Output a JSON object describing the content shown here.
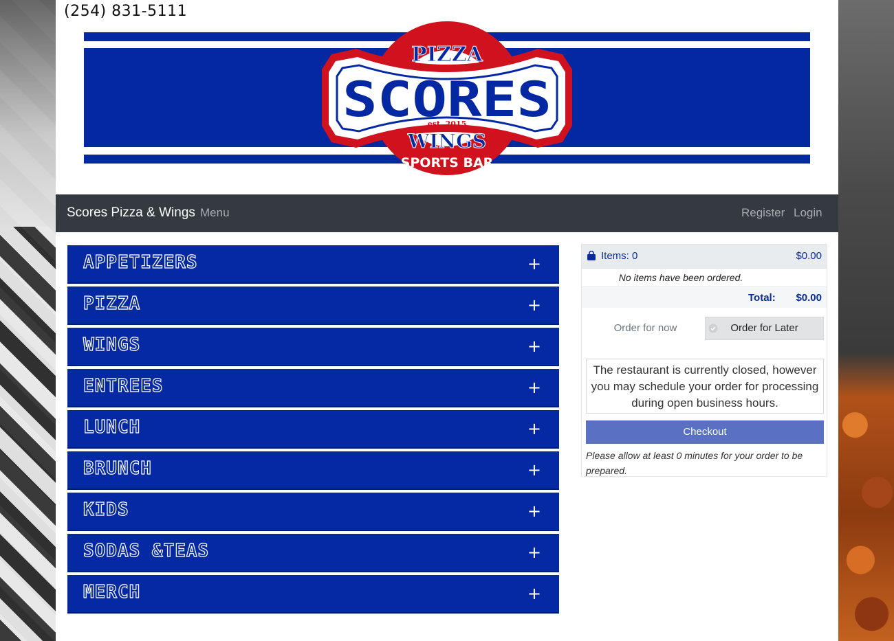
{
  "header": {
    "phone": "(254) 831-5111",
    "logo": {
      "top_text": "PIZZA",
      "main_text": "SCORES",
      "est_text": "est. 2015",
      "lower_text": "WINGS",
      "bottom_text": "SPORTS BAR",
      "colors": {
        "blue": "#0428a2",
        "red": "#d0121e",
        "white": "#ffffff"
      }
    }
  },
  "navbar": {
    "brand": "Scores Pizza & Wings",
    "menu_link": "Menu",
    "register_link": "Register",
    "login_link": "Login"
  },
  "menu": {
    "categories": [
      {
        "label": "APPETIZERS",
        "toggle": "+"
      },
      {
        "label": "PIZZA",
        "toggle": "+"
      },
      {
        "label": "WINGS",
        "toggle": "+"
      },
      {
        "label": "ENTREES",
        "toggle": "+"
      },
      {
        "label": "LUNCH",
        "toggle": "+"
      },
      {
        "label": "BRUNCH",
        "toggle": "+"
      },
      {
        "label": "KIDS",
        "toggle": "+"
      },
      {
        "label": "SODAS &TEAS",
        "toggle": "+"
      },
      {
        "label": "MERCH",
        "toggle": "+"
      }
    ],
    "accent_color": "#0529a3"
  },
  "cart": {
    "icon": "shopping-bag-icon",
    "items_label": "Items: 0",
    "header_amount": "$0.00",
    "empty_message": "No items have been ordered.",
    "total_label": "Total:",
    "total_value": "$0.00",
    "order_now_label": "Order for now",
    "order_later_label": "Order for Later",
    "closed_message": "The restaurant is currently closed, however you may schedule your order for processing during open business hours.",
    "checkout_label": "Checkout",
    "prep_note": "Please allow at least 0 minutes for your order to be prepared.",
    "checkout_color": "#5a70c2"
  }
}
